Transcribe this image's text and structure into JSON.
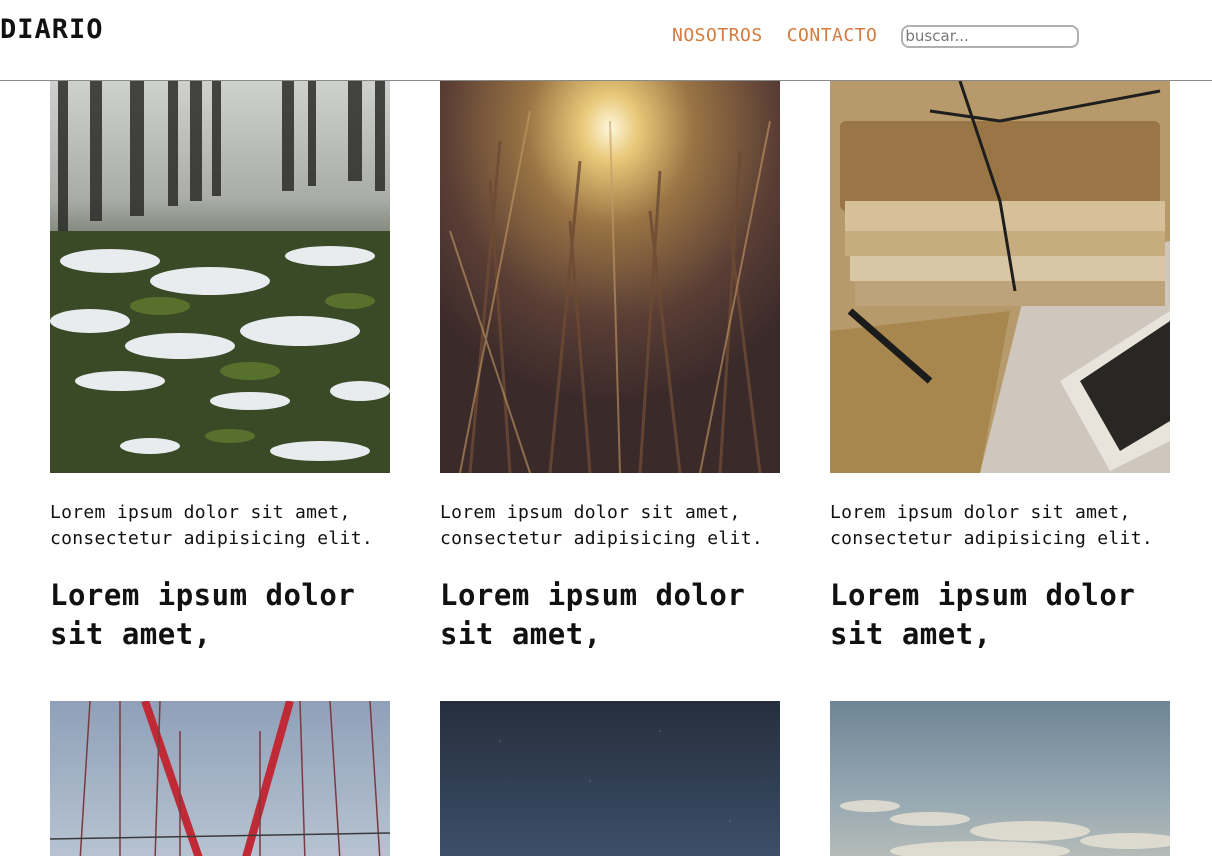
{
  "header": {
    "logo": "DIARIO",
    "nav": [
      {
        "label": "NOSOTROS"
      },
      {
        "label": "CONTACTO"
      }
    ],
    "search": {
      "placeholder": "buscar..."
    }
  },
  "posts": [
    {
      "excerpt": "Lorem ipsum dolor sit amet, consectetur adipisicing elit.",
      "title": "Lorem ipsum dolor sit amet,",
      "image": "snowy-forest"
    },
    {
      "excerpt": "Lorem ipsum dolor sit amet, consectetur adipisicing elit.",
      "title": "Lorem ipsum dolor sit amet,",
      "image": "sunlit-grass"
    },
    {
      "excerpt": "Lorem ipsum dolor sit amet, consectetur adipisicing elit.",
      "title": "Lorem ipsum dolor sit amet,",
      "image": "bundled-letters"
    },
    {
      "image": "red-bridge"
    },
    {
      "image": "night-sky"
    },
    {
      "image": "clouds-sky"
    }
  ],
  "colors": {
    "nav_link": "#d47b3e",
    "header_border": "#8a8a8a"
  }
}
